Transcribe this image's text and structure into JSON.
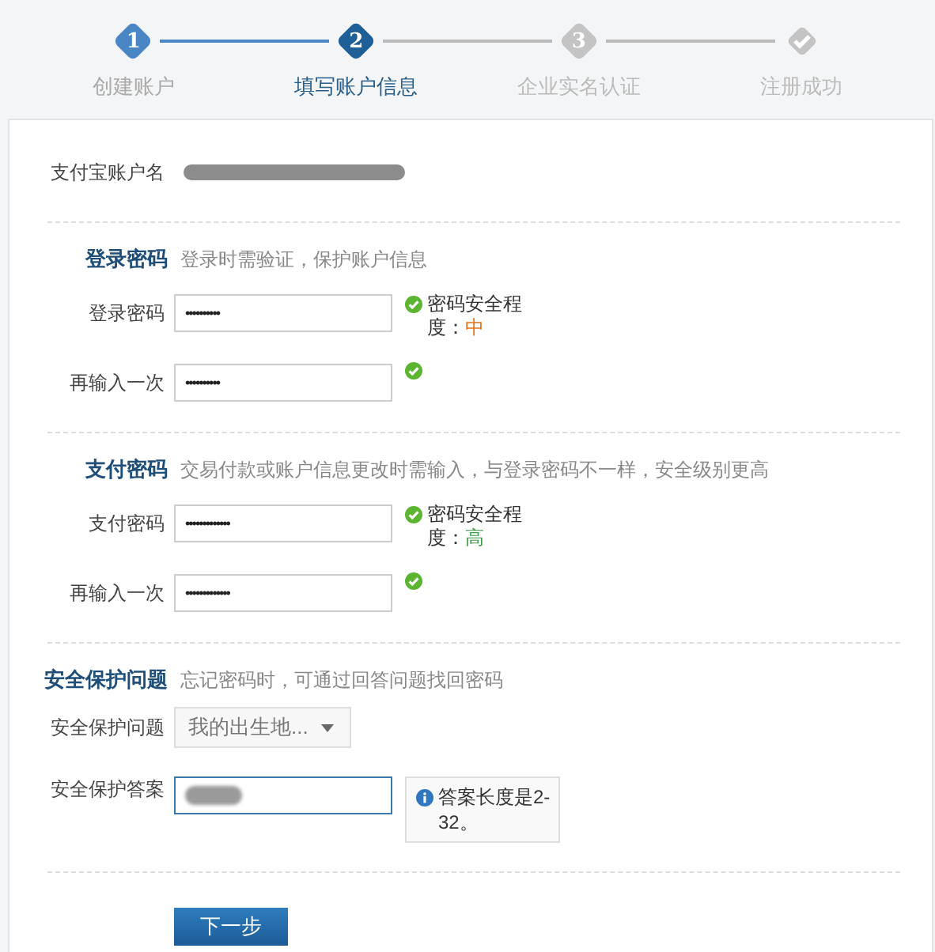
{
  "steps": [
    {
      "kind": "number",
      "number": "1",
      "label": "创建账户",
      "reached": true,
      "selected": false
    },
    {
      "kind": "number",
      "number": "2",
      "label": "填写账户信息",
      "reached": true,
      "selected": true
    },
    {
      "kind": "number",
      "number": "3",
      "label": "企业实名认证",
      "reached": false,
      "selected": false
    },
    {
      "kind": "check",
      "label": "注册成功",
      "reached": false,
      "selected": false
    }
  ],
  "account": {
    "label": "支付宝账户名",
    "redacted": true
  },
  "sections": [
    {
      "title": "登录密码",
      "hint": "登录时需验证，保护账户信息",
      "fields": [
        {
          "kind": "password",
          "label": "登录密码",
          "value": "••••••••••",
          "valid": true,
          "strength": {
            "label": "密码安全程度：",
            "value": "中",
            "color": "#e0761d"
          }
        },
        {
          "kind": "password",
          "label": "再输入一次",
          "value": "••••••••••",
          "valid": true
        }
      ]
    },
    {
      "title": "支付密码",
      "hint": "交易付款或账户信息更改时需输入，与登录密码不一样，安全级别更高",
      "fields": [
        {
          "kind": "password",
          "label": "支付密码",
          "value": "•••••••••••••",
          "valid": true,
          "strength": {
            "label": "密码安全程度：",
            "value": "高",
            "color": "#3f9a4a"
          }
        },
        {
          "kind": "password",
          "label": "再输入一次",
          "value": "•••••••••••••",
          "valid": true
        }
      ]
    },
    {
      "title": "安全保护问题",
      "hint": "忘记密码时，可通过回答问题找回密码",
      "fields": [
        {
          "kind": "select",
          "label": "安全保护问题",
          "value": "我的出生地..."
        },
        {
          "kind": "answer",
          "label": "安全保护答案",
          "redacted": true,
          "focused": true,
          "tip": "答案长度是2-32。"
        }
      ]
    }
  ],
  "next_button": "下一步"
}
